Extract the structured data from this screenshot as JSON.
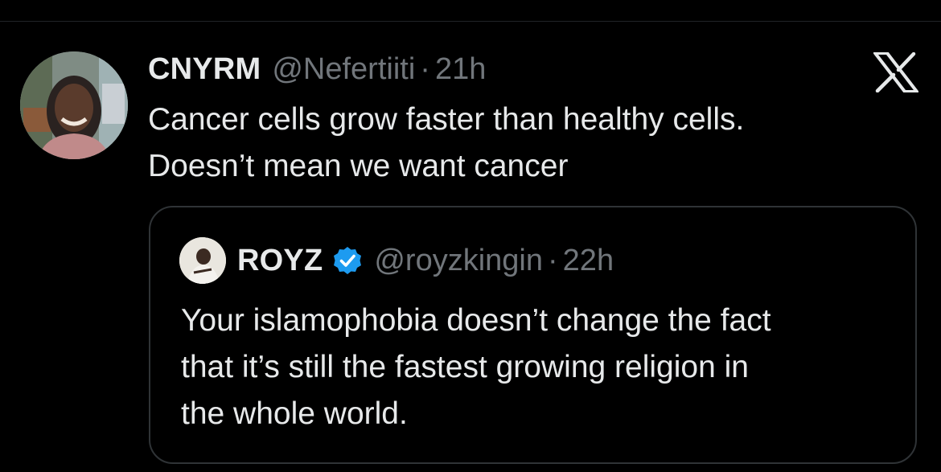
{
  "tweet": {
    "author": {
      "display_name": "CNYRM",
      "handle": "@Nefertiiti",
      "separator": "·",
      "time": "21h",
      "avatar_icon": "user-photo-avatar"
    },
    "text_lines": [
      "Cancer cells grow faster than healthy cells.",
      "Doesn’t mean we want cancer"
    ],
    "close_icon": "x-logo-icon"
  },
  "quoted_tweet": {
    "author": {
      "display_name": "ROYZ",
      "verified": true,
      "verified_icon": "verified-badge-icon",
      "handle": "@royzkingin",
      "separator": "·",
      "time": "22h",
      "avatar_icon": "user-photo-avatar"
    },
    "text_lines": [
      "Your islamophobia doesn’t change the fact",
      "that it’s still the fastest growing religion in",
      "the whole world."
    ]
  },
  "colors": {
    "background": "#000000",
    "primary_text": "#e7e9ea",
    "secondary_text": "#71767b",
    "border": "#2f3336",
    "verified_blue": "#1d9bf0"
  }
}
